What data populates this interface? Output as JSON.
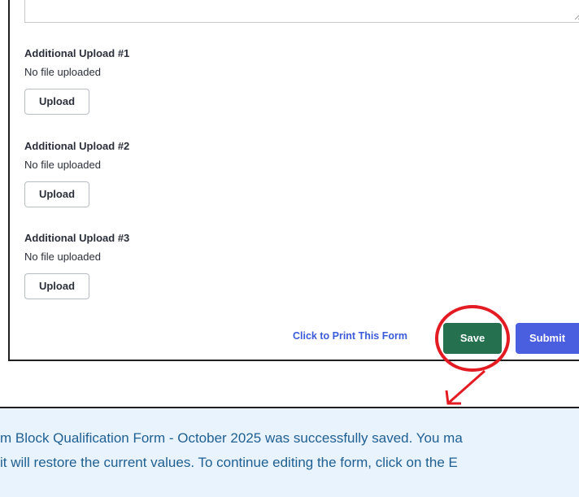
{
  "uploads": [
    {
      "label": "Additional Upload #1",
      "status": "No file uploaded",
      "button": "Upload"
    },
    {
      "label": "Additional Upload #2",
      "status": "No file uploaded",
      "button": "Upload"
    },
    {
      "label": "Additional Upload #3",
      "status": "No file uploaded",
      "button": "Upload"
    }
  ],
  "actions": {
    "print_link": "Click to Print This Form",
    "save": "Save",
    "submit": "Submit"
  },
  "message": {
    "line1": "m Block Qualification Form - October 2025 was successfully saved. You ma",
    "line2": "it will restore the current values. To continue editing the form, click on the E"
  },
  "colors": {
    "save_button": "#24704f",
    "submit_button": "#4a5ee0",
    "link": "#3b5bdb",
    "annotation": "#e31b23",
    "message_background": "#e8f3fd",
    "message_text": "#1f5f92"
  }
}
